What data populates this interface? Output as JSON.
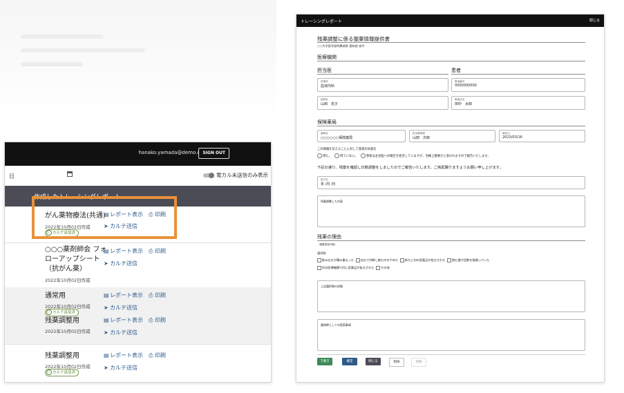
{
  "left_panel": {
    "email": "hanako.yamada@demo.co.jp",
    "sign_out": "SIGN OUT",
    "date_partial": "日",
    "toggle_label": "電カル未送信のみ表示",
    "list_title": "作成したトレーシングレポート",
    "link_report": "レポート表示",
    "link_print": "印刷",
    "link_send": "カルテ送信",
    "badge": "カルテ送信済",
    "rows": [
      {
        "name": "がん薬物療法(共通)",
        "date": "2022年10月02日作成"
      },
      {
        "name1": "○○○薬剤師会 フォ",
        "name2": "ローアップシート",
        "name3": "（抗がん薬）",
        "date": "2022年10月02日作成"
      },
      {
        "name": "通常用",
        "date": "2022年10月02日作成",
        "name_b": "残薬調整用",
        "date_b": "2022年10月02日作成"
      },
      {
        "name": "残薬調整用",
        "date": "2022年10月02日作成"
      }
    ]
  },
  "right_panel": {
    "title": "トレーシングレポート",
    "close": "閉じる",
    "doc_title": "残薬調整に係る服薬情報提供書",
    "doc_sub": "○○大学医学部附属病院 薬剤部 宛中",
    "medical": "医療機関",
    "doctor": "担当医",
    "patient": "患者",
    "dept_label": "診療科",
    "dept": "血液内科",
    "pid_label": "患者番号",
    "pid": "0000000000",
    "dr_name_label": "医師名",
    "dr_name": "山田　花子",
    "pname_label": "患者氏名",
    "pname": "田中　太郎",
    "pharmacy": "保険薬局",
    "ph_name_label": "薬局名",
    "ph_name": "○○○○○○保険薬局",
    "pharmacist_label": "担当薬剤師",
    "pharmacist": "山田　次郎",
    "date_label": "報告日",
    "date": "2023/03/16",
    "consent": "この情報を伝えることに対して患者の同意を",
    "r1": "得た。",
    "r2": "得ていない。",
    "r3": "患者は主治医への報告を拒否していますが、治療上重要だと思われますので報告いたします。",
    "intro": "下記の通り、残薬を確認し日数調整をしましたのでご報告いたします。ご高配賜りますようお願い申し上げます。",
    "field_date_label": "処方日",
    "field_date": "年 /月 /日",
    "adjust_label": "残薬調整した内容",
    "reason": "残薬の理由",
    "reason_note": "（複数回答可能）",
    "reason_sub": "選択肢",
    "c1": "飲み忘れが積み重なった",
    "c2": "自分で判断し飲むのをやめた",
    "c3": "新たに別の医薬品が処方された",
    "c4": "飲む量や回数を間違っていた",
    "c5": "別の医療機関で同じ医薬品が処方された",
    "c6": "その他",
    "detail_label": "上記選択肢の詳細",
    "proposal_label": "薬剤師としての提案事項",
    "btn_save": "下書き",
    "btn_confirm": "確定",
    "btn_close": "閉じる",
    "btn_delete": "削除",
    "btn_print": "印刷"
  },
  "colors": {
    "highlight": "#e8913a",
    "link": "#2f5b8a",
    "badge": "#5c8a3c",
    "save": "#3d8a56",
    "confirm": "#2d5a87"
  }
}
